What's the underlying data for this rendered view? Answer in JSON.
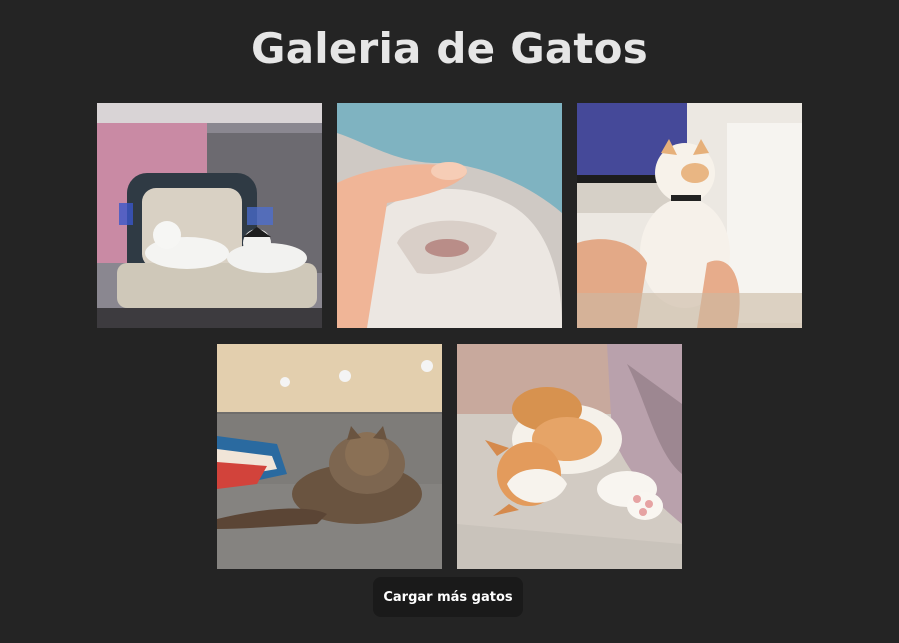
{
  "page": {
    "title": "Galeria de Gatos"
  },
  "gallery": {
    "photos": [
      {
        "alt": "Dos gatos blancos y negro en una silla"
      },
      {
        "alt": "Mano acariciando la barbilla de un gato"
      },
      {
        "alt": "Gato blanco y naranja sostenido frente a un televisor"
      },
      {
        "alt": "Gato atigrado recostado en un sofá"
      },
      {
        "alt": "Gato naranja y blanco durmiendo en una manta"
      }
    ]
  },
  "actions": {
    "load_more_label": "Cargar más gatos"
  },
  "colors": {
    "background": "#242424",
    "title": "#e6e6e6",
    "button_bg": "#1a1a1a",
    "button_text": "#ffffff"
  }
}
